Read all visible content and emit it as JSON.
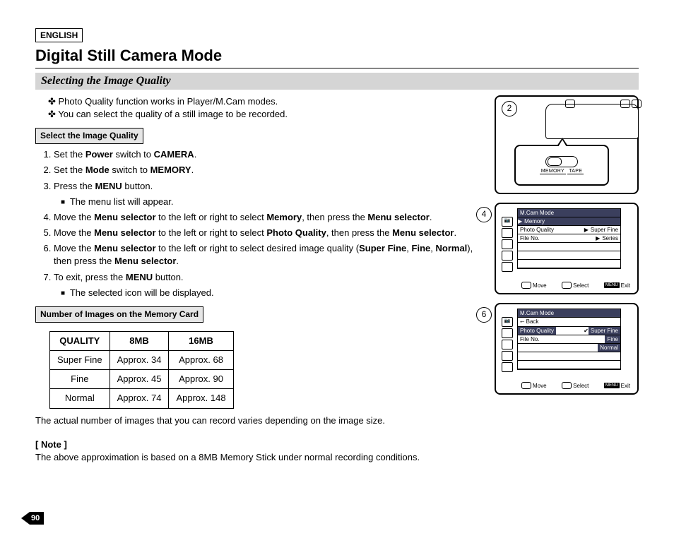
{
  "lang": "ENGLISH",
  "title": "Digital Still Camera Mode",
  "subheader": "Selecting the Image Quality",
  "intro_bullets": [
    "Photo Quality function works in Player/M.Cam modes.",
    "You can select the quality of a still image to be recorded."
  ],
  "select_box": "Select the Image Quality",
  "steps": {
    "s1a": "Set the ",
    "s1b": "Power",
    "s1c": " switch to ",
    "s1d": "CAMERA",
    "s1e": ".",
    "s2a": "Set the ",
    "s2b": "Mode",
    "s2c": " switch to ",
    "s2d": "MEMORY",
    "s2e": ".",
    "s3a": "Press the ",
    "s3b": "MENU",
    "s3c": " button.",
    "s3_sub": "The menu list will appear.",
    "s4a": "Move the ",
    "s4b": "Menu selector",
    "s4c": " to the left or right to select ",
    "s4d": "Memory",
    "s4e": ", then press the ",
    "s4f": "Menu selector",
    "s4g": ".",
    "s5a": "Move the ",
    "s5b": "Menu selector",
    "s5c": " to the left or right to select ",
    "s5d": "Photo Quality",
    "s5e": ", then press the ",
    "s5f": "Menu selector",
    "s5g": ".",
    "s6a": "Move the ",
    "s6b": "Menu selector",
    "s6c": " to the left or right to select desired image quality (",
    "s6d": "Super Fine",
    "s6e": ", ",
    "s6f": "Fine",
    "s6g": ", ",
    "s6h": "Normal",
    "s6i": "), then press the ",
    "s6j": "Menu selector",
    "s6k": ".",
    "s7a": "To exit, press the ",
    "s7b": "MENU",
    "s7c": " button.",
    "s7_sub": "The selected icon will be displayed."
  },
  "table_title": "Number of Images on the Memory Card",
  "table": {
    "headers": [
      "QUALITY",
      "8MB",
      "16MB"
    ],
    "rows": [
      [
        "Super Fine",
        "Approx. 34",
        "Approx. 68"
      ],
      [
        "Fine",
        "Approx. 45",
        "Approx. 90"
      ],
      [
        "Normal",
        "Approx. 74",
        "Approx. 148"
      ]
    ]
  },
  "table_note": "The actual number of images that you can record varies depending on the image size.",
  "note_head": "[ Note ]",
  "note_body": "The above approximation is based on a 8MB Memory Stick under normal recording conditions.",
  "page_number": "90",
  "callouts": {
    "d1": "2",
    "d2": "4",
    "d3": "6"
  },
  "switch": {
    "memory": "MEMORY",
    "tape": "TAPE"
  },
  "menu4": {
    "mode": "M.Cam Mode",
    "memory": "Memory",
    "photo_quality": "Photo Quality",
    "file_no": "File No.",
    "val1": "Super Fine",
    "val2": "Series"
  },
  "menu6": {
    "mode": "M.Cam Mode",
    "back": "Back",
    "photo_quality": "Photo Quality",
    "file_no": "File No.",
    "o1": "Super Fine",
    "o2": "Fine",
    "o3": "Normal"
  },
  "controls": {
    "move": "Move",
    "select": "Select",
    "menu": "MENU",
    "exit": "Exit"
  }
}
